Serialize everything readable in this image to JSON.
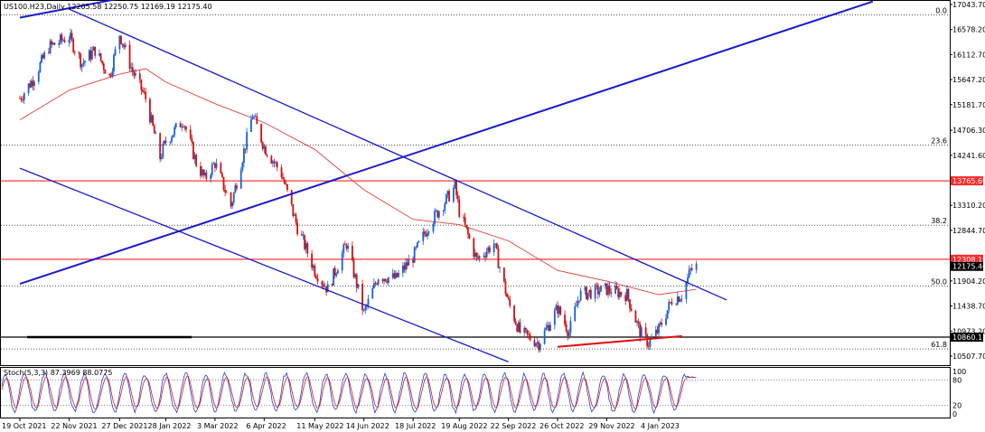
{
  "chart_data": [
    {
      "type": "candlestick",
      "title": "US100.H23,Daily  12205.58 12250.75 12169.19 12175.40",
      "y_ticks": [
        17043.7,
        16578.2,
        16112.7,
        15647.2,
        15181.7,
        14706.3,
        14241.6,
        13765.69,
        13310.2,
        12844.7,
        12308.19,
        12175.4,
        11904.2,
        11438.7,
        10973.2,
        10860.11,
        10507.7
      ],
      "price_labels": [
        {
          "value": 13765.69,
          "color": "#ff2a2a",
          "text": "13765.69"
        },
        {
          "value": 12308.19,
          "color": "#ff2a2a",
          "text": "12308.19"
        },
        {
          "value": 12175.4,
          "color": "#000000",
          "text": "12175.40"
        },
        {
          "value": 10860.11,
          "color": "#000000",
          "text": "10860.11"
        }
      ],
      "fib_levels": [
        {
          "label": "0.0",
          "value": 16850
        },
        {
          "label": "23.6",
          "value": 14430
        },
        {
          "label": "38.2",
          "value": 12940
        },
        {
          "label": "50.0",
          "value": 11810
        },
        {
          "label": "61.8",
          "value": 10640
        }
      ],
      "x_labels": [
        "19 Oct 2021",
        "22 Nov 2021",
        "27 Dec 2021",
        "28 Jan 2022",
        "3 Mar 2022",
        "6 Apr 2022",
        "11 May 2022",
        "14 Jun 2022",
        "18 Jul 2022",
        "19 Aug 2022",
        "22 Sep 2022",
        "26 Oct 2022",
        "29 Nov 2022",
        "4 Jan 2023"
      ],
      "x_label_dates": [
        "2021-10-19",
        "2021-11-22",
        "2021-12-27",
        "2022-01-28",
        "2022-03-03",
        "2022-04-06",
        "2022-05-11",
        "2022-06-14",
        "2022-07-18",
        "2022-08-19",
        "2022-09-22",
        "2022-10-26",
        "2022-11-29",
        "2023-01-04"
      ],
      "closes": [
        {
          "date": "2021-10-19",
          "value": 15300
        },
        {
          "date": "2021-10-28",
          "value": 15650
        },
        {
          "date": "2021-11-08",
          "value": 16250
        },
        {
          "date": "2021-11-22",
          "value": 16450
        },
        {
          "date": "2021-12-01",
          "value": 15950
        },
        {
          "date": "2021-12-10",
          "value": 16200
        },
        {
          "date": "2021-12-20",
          "value": 15700
        },
        {
          "date": "2021-12-27",
          "value": 16500
        },
        {
          "date": "2022-01-05",
          "value": 15800
        },
        {
          "date": "2022-01-14",
          "value": 15300
        },
        {
          "date": "2022-01-24",
          "value": 14200
        },
        {
          "date": "2022-01-28",
          "value": 14500
        },
        {
          "date": "2022-02-09",
          "value": 14900
        },
        {
          "date": "2022-02-18",
          "value": 14100
        },
        {
          "date": "2022-02-24",
          "value": 13800
        },
        {
          "date": "2022-03-03",
          "value": 14100
        },
        {
          "date": "2022-03-14",
          "value": 13300
        },
        {
          "date": "2022-03-29",
          "value": 15000
        },
        {
          "date": "2022-04-06",
          "value": 14400
        },
        {
          "date": "2022-04-18",
          "value": 13900
        },
        {
          "date": "2022-04-29",
          "value": 12900
        },
        {
          "date": "2022-05-11",
          "value": 12100
        },
        {
          "date": "2022-05-20",
          "value": 11750
        },
        {
          "date": "2022-06-02",
          "value": 12600
        },
        {
          "date": "2022-06-14",
          "value": 11300
        },
        {
          "date": "2022-06-24",
          "value": 12000
        },
        {
          "date": "2022-07-06",
          "value": 11950
        },
        {
          "date": "2022-07-18",
          "value": 12350
        },
        {
          "date": "2022-07-29",
          "value": 12950
        },
        {
          "date": "2022-08-16",
          "value": 13650
        },
        {
          "date": "2022-08-19",
          "value": 13200
        },
        {
          "date": "2022-08-31",
          "value": 12300
        },
        {
          "date": "2022-09-12",
          "value": 12600
        },
        {
          "date": "2022-09-22",
          "value": 11500
        },
        {
          "date": "2022-09-30",
          "value": 10950
        },
        {
          "date": "2022-10-13",
          "value": 10750
        },
        {
          "date": "2022-10-26",
          "value": 11400
        },
        {
          "date": "2022-11-03",
          "value": 10950
        },
        {
          "date": "2022-11-10",
          "value": 11650
        },
        {
          "date": "2022-11-29",
          "value": 11750
        },
        {
          "date": "2022-12-13",
          "value": 11650
        },
        {
          "date": "2022-12-22",
          "value": 10950
        },
        {
          "date": "2022-12-28",
          "value": 10750
        },
        {
          "date": "2023-01-04",
          "value": 11000
        },
        {
          "date": "2023-01-13",
          "value": 11550
        },
        {
          "date": "2023-01-20",
          "value": 11650
        },
        {
          "date": "2023-01-26",
          "value": 12100
        },
        {
          "date": "2023-01-30",
          "value": 12175
        }
      ],
      "ma_series": [
        {
          "date": "2021-10-19",
          "value": 14900
        },
        {
          "date": "2021-11-22",
          "value": 15450
        },
        {
          "date": "2021-12-27",
          "value": 15750
        },
        {
          "date": "2022-01-14",
          "value": 15850
        },
        {
          "date": "2022-01-28",
          "value": 15600
        },
        {
          "date": "2022-03-03",
          "value": 15200
        },
        {
          "date": "2022-04-06",
          "value": 14850
        },
        {
          "date": "2022-05-11",
          "value": 14350
        },
        {
          "date": "2022-06-14",
          "value": 13600
        },
        {
          "date": "2022-07-18",
          "value": 13050
        },
        {
          "date": "2022-08-19",
          "value": 12950
        },
        {
          "date": "2022-09-22",
          "value": 12650
        },
        {
          "date": "2022-10-26",
          "value": 12100
        },
        {
          "date": "2022-11-29",
          "value": 11900
        },
        {
          "date": "2023-01-04",
          "value": 11650
        },
        {
          "date": "2023-01-30",
          "value": 11750
        }
      ],
      "trendlines": [
        {
          "color": "#1a1acc",
          "from": {
            "date": "2021-10-19",
            "value": 16800
          },
          "to": {
            "date": "2022-01-05",
            "value": 17200
          }
        },
        {
          "color": "#1a1acc",
          "from": {
            "date": "2021-10-19",
            "value": 11850
          },
          "to": {
            "date": "2023-06-01",
            "value": 17100
          }
        },
        {
          "color": "#1a1acc",
          "from": {
            "date": "2021-11-22",
            "value": 16960
          },
          "to": {
            "date": "2023-02-20",
            "value": 11550
          }
        },
        {
          "color": "#1a1acc",
          "from": {
            "date": "2021-10-19",
            "value": 14000
          },
          "to": {
            "date": "2022-09-22",
            "value": 10400
          }
        },
        {
          "color": "#e01010",
          "from": {
            "date": "2022-10-26",
            "value": 10680
          },
          "to": {
            "date": "2023-01-20",
            "value": 10880
          }
        }
      ],
      "horizontal_lines": [
        {
          "value": 13765.69,
          "color": "#ff3b3b",
          "style": "solid"
        },
        {
          "value": 12308.19,
          "color": "#ff3b3b",
          "style": "solid"
        },
        {
          "value": 10860.11,
          "color": "#000000",
          "style": "solid"
        }
      ],
      "ylim": [
        10450,
        17100
      ]
    },
    {
      "type": "line",
      "title": "Stoch(5,3,3) 87.3969 88.0775",
      "y_ticks": [
        100,
        80,
        20,
        0
      ],
      "levels": [
        80,
        20
      ],
      "series": [
        {
          "name": "main",
          "color": "#2040d0"
        },
        {
          "name": "signal",
          "color": "#d02020"
        }
      ],
      "last_values": [
        87.3969,
        88.0775
      ],
      "ylim": [
        0,
        100
      ]
    }
  ]
}
